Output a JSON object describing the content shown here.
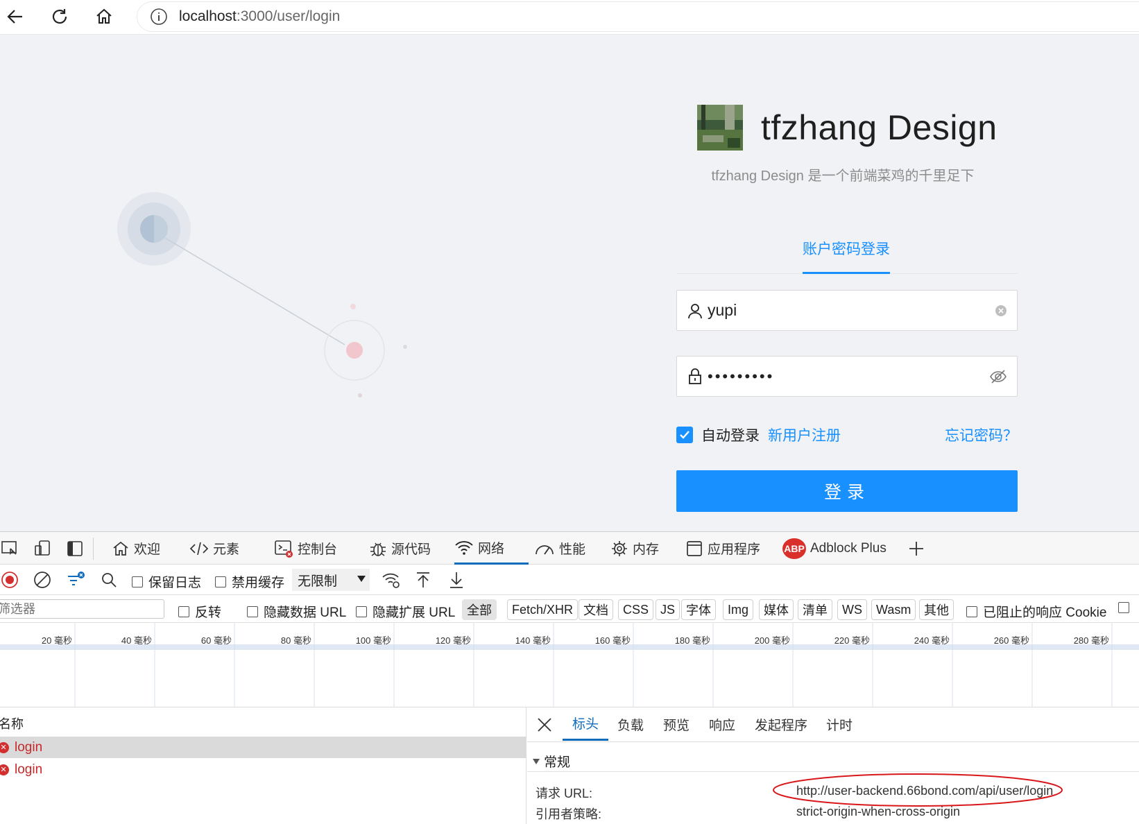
{
  "browser": {
    "url_host": "localhost",
    "url_path": ":3000/user/login"
  },
  "login_page": {
    "app_title": "tfzhang Design",
    "app_description": "tfzhang Design 是一个前端菜鸡的千里足下",
    "tab_label": "账户密码登录",
    "username_value": "yupi",
    "password_mask": "•••••••••",
    "auto_login_label": "自动登录",
    "auto_login_checked": true,
    "register_link": "新用户注册",
    "forgot_link": "忘记密码？",
    "login_button": "登录",
    "accent_color": "#1890ff"
  },
  "devtools": {
    "tabs": [
      {
        "label": "欢迎",
        "icon": "home-icon"
      },
      {
        "label": "元素",
        "icon": "code-icon"
      },
      {
        "label": "控制台",
        "icon": "console-icon"
      },
      {
        "label": "源代码",
        "icon": "bug-icon"
      },
      {
        "label": "网络",
        "icon": "wifi-icon",
        "active": true
      },
      {
        "label": "性能",
        "icon": "gauge-icon"
      },
      {
        "label": "内存",
        "icon": "chip-icon"
      },
      {
        "label": "应用程序",
        "icon": "window-icon"
      },
      {
        "label": "Adblock Plus",
        "icon": "abp-icon"
      }
    ],
    "abp_badge": "ABP",
    "toolbar": {
      "preserve_log": "保留日志",
      "disable_cache": "禁用缓存",
      "throttle": "无限制"
    },
    "filter": {
      "placeholder": "筛选器",
      "invert": "反转",
      "hide_data_urls": "隐藏数据 URL",
      "hide_ext_urls": "隐藏扩展 URL",
      "chips": [
        "全部",
        "Fetch/XHR",
        "文档",
        "CSS",
        "JS",
        "字体",
        "Img",
        "媒体",
        "清单",
        "WS",
        "Wasm",
        "其他"
      ],
      "blocked_cookies": "已阻止的响应 Cookie"
    },
    "timeline_ticks": [
      "20 毫秒",
      "40 毫秒",
      "60 毫秒",
      "80 毫秒",
      "100 毫秒",
      "120 毫秒",
      "140 毫秒",
      "160 毫秒",
      "180 毫秒",
      "200 毫秒",
      "220 毫秒",
      "240 毫秒",
      "260 毫秒",
      "280 毫秒"
    ],
    "request_list": {
      "column_name": "名称",
      "requests": [
        {
          "name": "login",
          "status": "error",
          "selected": true
        },
        {
          "name": "login",
          "status": "error",
          "selected": false
        }
      ]
    },
    "details": {
      "tabs": [
        "标头",
        "负载",
        "预览",
        "响应",
        "发起程序",
        "计时"
      ],
      "active_tab": "标头",
      "section": "常规",
      "request_url_key": "请求 URL:",
      "request_url_value": "http://user-backend.66bond.com/api/user/login",
      "referrer_policy_key": "引用者策略:",
      "referrer_policy_value": "strict-origin-when-cross-origin"
    }
  }
}
